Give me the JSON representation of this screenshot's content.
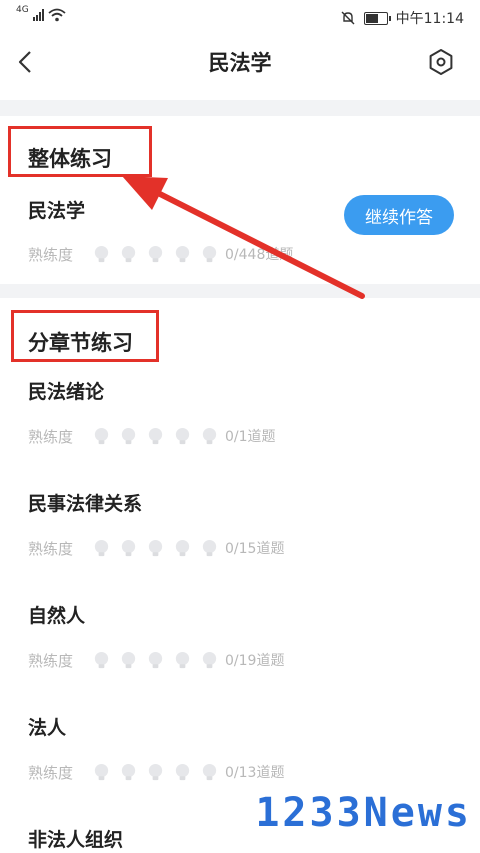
{
  "status_bar": {
    "network": "4G",
    "time": "中午11:14",
    "icons": [
      "signal-icon",
      "wifi-icon",
      "mute-icon",
      "battery-icon"
    ]
  },
  "nav": {
    "title": "民法学",
    "back_icon": "chevron-left-icon",
    "settings_icon": "hexagon-settings-icon"
  },
  "overall": {
    "section_title": "整体练习",
    "item_title": "民法学",
    "proficiency_label": "熟练度",
    "progress": "0/448道题",
    "continue_label": "继续作答",
    "bulbs_lit": 0,
    "bulbs_total": 5
  },
  "chapters": {
    "section_title": "分章节练习",
    "items": [
      {
        "title": "民法绪论",
        "proficiency_label": "熟练度",
        "progress": "0/1道题",
        "bulbs_lit": 0
      },
      {
        "title": "民事法律关系",
        "proficiency_label": "熟练度",
        "progress": "0/15道题",
        "bulbs_lit": 0
      },
      {
        "title": "自然人",
        "proficiency_label": "熟练度",
        "progress": "0/19道题",
        "bulbs_lit": 0
      },
      {
        "title": "法人",
        "proficiency_label": "熟练度",
        "progress": "0/13道题",
        "bulbs_lit": 0
      },
      {
        "title": "非法人组织",
        "proficiency_label": "",
        "progress": "",
        "bulbs_lit": 0
      }
    ]
  },
  "annotation_color": "#e33129",
  "accent_color": "#3b9cf0",
  "watermark": "1233News"
}
